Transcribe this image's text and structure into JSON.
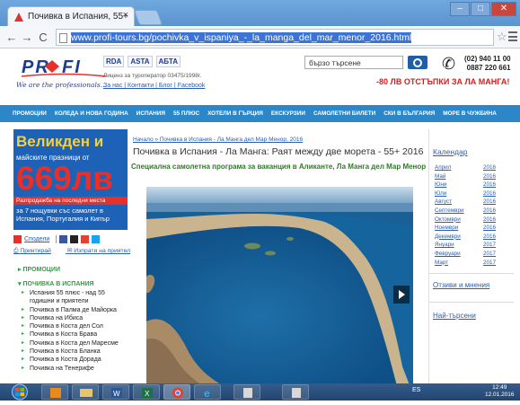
{
  "browser": {
    "tab_title": "Почивка в Испания, 55+",
    "tab_close": "×",
    "url_prefix": "",
    "url": "www.profi-tours.bg/pochivka_v_ispaniya_-_la_manga_del_mar_menor_2016.html",
    "win_min": "–",
    "win_max": "□",
    "win_close": "✕"
  },
  "header": {
    "logo_text": "PR◆FI",
    "slogan": "We are the professionals...",
    "assoc": [
      "RDA",
      "ASTA",
      "АБТА"
    ],
    "license": "Лиценз за туроператор 03475/1998г.",
    "links": "За нас | Контакти | Блог | Facebook",
    "search_placeholder": "бързо търсене",
    "phone1": "(02) 940 11 00",
    "phone2": "0887 220 661",
    "promo": "-80 ЛВ ОТСТЪПКИ ЗА ЛА МАНГА!"
  },
  "nav": [
    "ПРОМОЦИИ",
    "КОЛЕДА И НОВА ГОДИНА",
    "ИСПАНИЯ",
    "55 ПЛЮС",
    "ХОТЕЛИ В ГЪРЦИЯ",
    "ЕКСКУРЗИИ",
    "САМОЛЕТНИ БИЛЕТИ",
    "СКИ В БЪЛГАРИЯ",
    "МОРЕ В ЧУЖБИНА"
  ],
  "banner": {
    "line1": "Великден и",
    "line2": "майските празници от",
    "price": "669лв",
    "strip": "Разпродажба на последни места",
    "line3": "за 7 нощувки със самолет в Испания, Португалия и Кипър"
  },
  "social": {
    "share": "Сподели",
    "print": "Принтирай",
    "email": "Изпрати на приятел"
  },
  "sidebar": {
    "promo_heading": "ПРОМОЦИИ",
    "spain_heading": "ПОЧИВКА В ИСПАНИЯ",
    "items": [
      "Испания 55 плюс - над 55 годишни и приятели",
      "Почивка в Палма де Майорка",
      "Почивка на Ибиса",
      "Почивка в Коста дел Сол",
      "Почивка в Коста Брава",
      "Почивка в Коста дел Маресме",
      "Почивка в Коста Бланка",
      "Почивка в Коста Дорада",
      "Почивка на Тенерифе"
    ]
  },
  "content": {
    "breadcrumb": "Начало » Почивка в Испания - Ла Манга дел Мар Менор, 2016",
    "title": "Почивка в Испания - Ла Манга: Раят между две морета - 55+ 2016",
    "subtitle": "Специална самолетна програма за ваканция в Аликанте, Ла Манга дел Мар Менор"
  },
  "calendar": {
    "title": "Календар",
    "rows": [
      [
        "Април",
        "2016"
      ],
      [
        "Май",
        "2016"
      ],
      [
        "Юни",
        "2016"
      ],
      [
        "Юли",
        "2016"
      ],
      [
        "Август",
        "2016"
      ],
      [
        "Септември",
        "2016"
      ],
      [
        "Октомври",
        "2016"
      ],
      [
        "Ноември",
        "2016"
      ],
      [
        "Декември",
        "2016"
      ],
      [
        "Януари",
        "2017"
      ],
      [
        "Февруари",
        "2017"
      ],
      [
        "Март",
        "2017"
      ]
    ]
  },
  "right_links": {
    "reviews": "Отзиви и мнения",
    "top_search": "Най-търсени"
  },
  "taskbar": {
    "lang": "ES",
    "time": "12:49",
    "date": "12.01.2016"
  }
}
